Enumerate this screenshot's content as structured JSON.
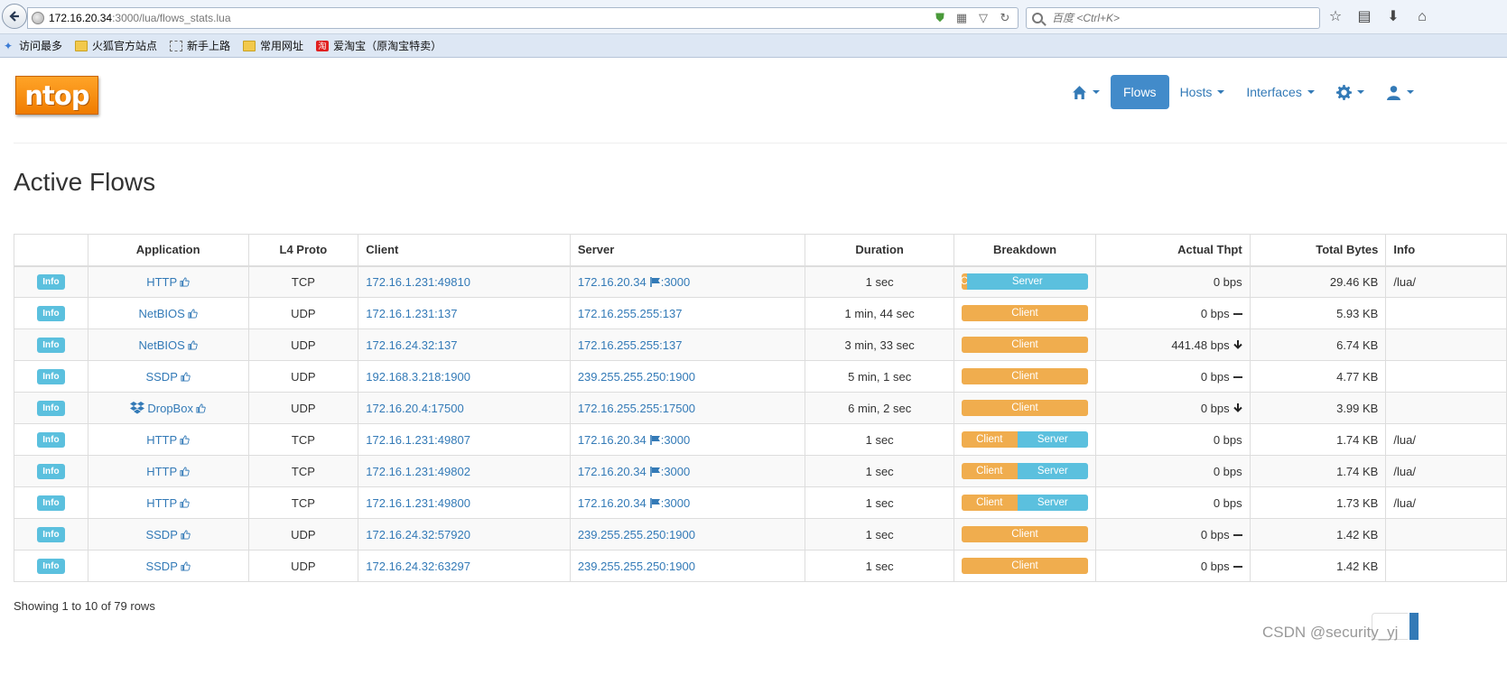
{
  "browser": {
    "url_host": "172.16.20.34",
    "url_path": ":3000/lua/flows_stats.lua",
    "search_placeholder": "百度 <Ctrl+K>",
    "bookmarks": [
      {
        "label": "访问最多",
        "icon": "star-icon"
      },
      {
        "label": "火狐官方站点",
        "icon": "folder-icon"
      },
      {
        "label": "新手上路",
        "icon": "dashed-folder-icon"
      },
      {
        "label": "常用网址",
        "icon": "folder-icon"
      },
      {
        "label": "爱淘宝（原淘宝特卖）",
        "icon": "taobao-icon"
      }
    ]
  },
  "app": {
    "logo": "ntop",
    "nav": {
      "flows": "Flows",
      "hosts": "Hosts",
      "interfaces": "Interfaces"
    },
    "page_title": "Active Flows",
    "accent_color": "#428bca",
    "info_color": "#5bc0de",
    "client_color": "#f0ad4e"
  },
  "table": {
    "headers": {
      "application": "Application",
      "l4": "L4 Proto",
      "client": "Client",
      "server": "Server",
      "duration": "Duration",
      "breakdown": "Breakdown",
      "thpt": "Actual Thpt",
      "bytes": "Total Bytes",
      "info": "Info"
    },
    "info_label": "Info",
    "rows": [
      {
        "app": "HTTP",
        "proto": "TCP",
        "client": "172.16.1.231:49810",
        "server_host": "172.16.20.34",
        "server_port": ":3000",
        "flag": true,
        "duration": "1 sec",
        "client_pct": 4,
        "client_label": "C",
        "server_label": "Server",
        "thpt": "0 bps",
        "trend": "none",
        "bytes": "29.46 KB",
        "info": "/lua/"
      },
      {
        "app": "NetBIOS",
        "proto": "UDP",
        "client": "172.16.1.231:137",
        "server_host": "172.16.255.255:137",
        "server_port": "",
        "flag": false,
        "duration": "1 min, 44 sec",
        "client_pct": 100,
        "client_label": "Client",
        "server_label": "",
        "thpt": "0 bps",
        "trend": "flat",
        "bytes": "5.93 KB",
        "info": ""
      },
      {
        "app": "NetBIOS",
        "proto": "UDP",
        "client": "172.16.24.32:137",
        "server_host": "172.16.255.255:137",
        "server_port": "",
        "flag": false,
        "duration": "3 min, 33 sec",
        "client_pct": 100,
        "client_label": "Client",
        "server_label": "",
        "thpt": "441.48 bps",
        "trend": "down",
        "bytes": "6.74 KB",
        "info": ""
      },
      {
        "app": "SSDP",
        "proto": "UDP",
        "client": "192.168.3.218:1900",
        "server_host": "239.255.255.250:1900",
        "server_port": "",
        "flag": false,
        "duration": "5 min, 1 sec",
        "client_pct": 100,
        "client_label": "Client",
        "server_label": "",
        "thpt": "0 bps",
        "trend": "flat",
        "bytes": "4.77 KB",
        "info": ""
      },
      {
        "app": "DropBox",
        "proto": "UDP",
        "client": "172.16.20.4:17500",
        "server_host": "172.16.255.255:17500",
        "server_port": "",
        "flag": false,
        "duration": "6 min, 2 sec",
        "client_pct": 100,
        "client_label": "Client",
        "server_label": "",
        "thpt": "0 bps",
        "trend": "down",
        "bytes": "3.99 KB",
        "info": ""
      },
      {
        "app": "HTTP",
        "proto": "TCP",
        "client": "172.16.1.231:49807",
        "server_host": "172.16.20.34",
        "server_port": ":3000",
        "flag": true,
        "duration": "1 sec",
        "client_pct": 44,
        "client_label": "Client",
        "server_label": "Server",
        "thpt": "0 bps",
        "trend": "none",
        "bytes": "1.74 KB",
        "info": "/lua/"
      },
      {
        "app": "HTTP",
        "proto": "TCP",
        "client": "172.16.1.231:49802",
        "server_host": "172.16.20.34",
        "server_port": ":3000",
        "flag": true,
        "duration": "1 sec",
        "client_pct": 44,
        "client_label": "Client",
        "server_label": "Server",
        "thpt": "0 bps",
        "trend": "none",
        "bytes": "1.74 KB",
        "info": "/lua/"
      },
      {
        "app": "HTTP",
        "proto": "TCP",
        "client": "172.16.1.231:49800",
        "server_host": "172.16.20.34",
        "server_port": ":3000",
        "flag": true,
        "duration": "1 sec",
        "client_pct": 44,
        "client_label": "Client",
        "server_label": "Server",
        "thpt": "0 bps",
        "trend": "none",
        "bytes": "1.73 KB",
        "info": "/lua/"
      },
      {
        "app": "SSDP",
        "proto": "UDP",
        "client": "172.16.24.32:57920",
        "server_host": "239.255.255.250:1900",
        "server_port": "",
        "flag": false,
        "duration": "1 sec",
        "client_pct": 100,
        "client_label": "Client",
        "server_label": "",
        "thpt": "0 bps",
        "trend": "flat",
        "bytes": "1.42 KB",
        "info": ""
      },
      {
        "app": "SSDP",
        "proto": "UDP",
        "client": "172.16.24.32:63297",
        "server_host": "239.255.255.250:1900",
        "server_port": "",
        "flag": false,
        "duration": "1 sec",
        "client_pct": 100,
        "client_label": "Client",
        "server_label": "",
        "thpt": "0 bps",
        "trend": "flat",
        "bytes": "1.42 KB",
        "info": ""
      }
    ]
  },
  "footer": {
    "showing": "Showing 1 to 10 of 79 rows",
    "watermark": "CSDN @security_yj"
  }
}
